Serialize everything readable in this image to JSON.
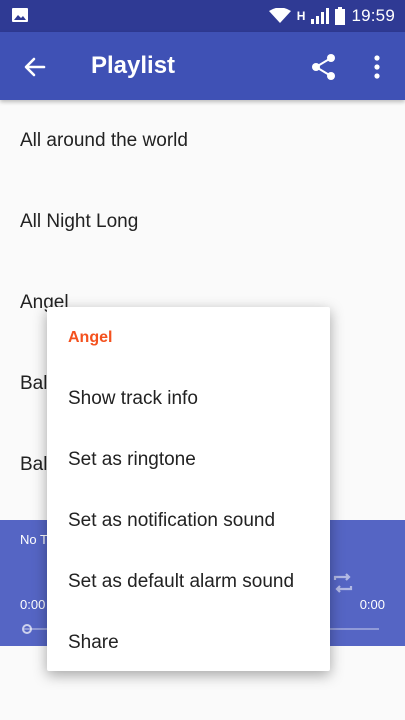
{
  "status_bar": {
    "time": "19:59",
    "network": "H",
    "icons": [
      "image-icon",
      "wifi-icon",
      "signal-icon",
      "battery-icon"
    ]
  },
  "app_bar": {
    "title": "Playlist",
    "icons": [
      "back-arrow-icon",
      "share-icon",
      "more-vert-icon"
    ]
  },
  "playlist": {
    "items": [
      "All around the world",
      "All Night Long",
      "Angel",
      "Bal",
      "Bal"
    ]
  },
  "player": {
    "track_label": "No T",
    "time_elapsed": "0:00",
    "time_total": "0:00",
    "progress": 0
  },
  "context_menu": {
    "title": "Angel",
    "items": [
      "Show track info",
      "Set as ringtone",
      "Set as notification sound",
      "Set as default alarm sound",
      "Share"
    ]
  },
  "colors": {
    "status_bar": "#2f3a94",
    "app_bar": "#3f51b5",
    "player": "#5565c4",
    "menu_title": "#f4511e"
  }
}
